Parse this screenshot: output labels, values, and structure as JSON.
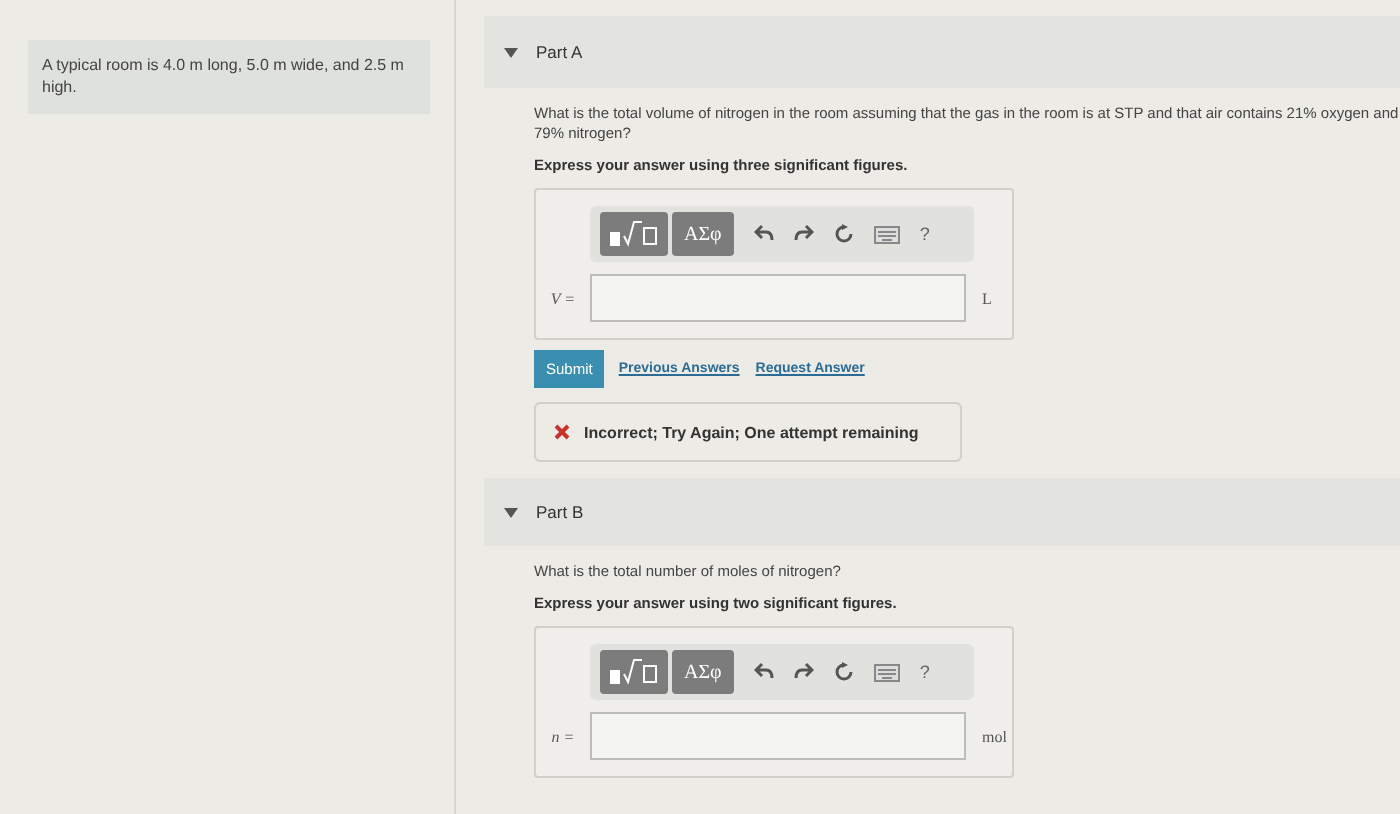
{
  "problem_statement": "A typical room is 4.0 m long, 5.0 m wide, and 2.5 m high.",
  "parts": [
    {
      "title": "Part A",
      "expanded": true,
      "question": "What is the total volume of nitrogen in the room assuming that the gas in the room is at STP and that air contains 21% oxygen and 79% nitrogen?",
      "instruction": "Express your answer using three significant figures.",
      "toolbar": {
        "symbols_button": "ΑΣφ",
        "help": "?"
      },
      "variable_label": "V =",
      "unit": "L",
      "submit": "Submit",
      "links": [
        "Previous Answers",
        "Request Answer"
      ],
      "feedback": {
        "kind": "incorrect",
        "text": "Incorrect; Try Again; One attempt remaining"
      }
    },
    {
      "title": "Part B",
      "expanded": true,
      "question": "What is the total number of moles of nitrogen?",
      "instruction": "Express your answer using two significant figures.",
      "toolbar": {
        "symbols_button": "ΑΣφ",
        "help": "?"
      },
      "variable_label": "n =",
      "unit": "mol"
    }
  ]
}
